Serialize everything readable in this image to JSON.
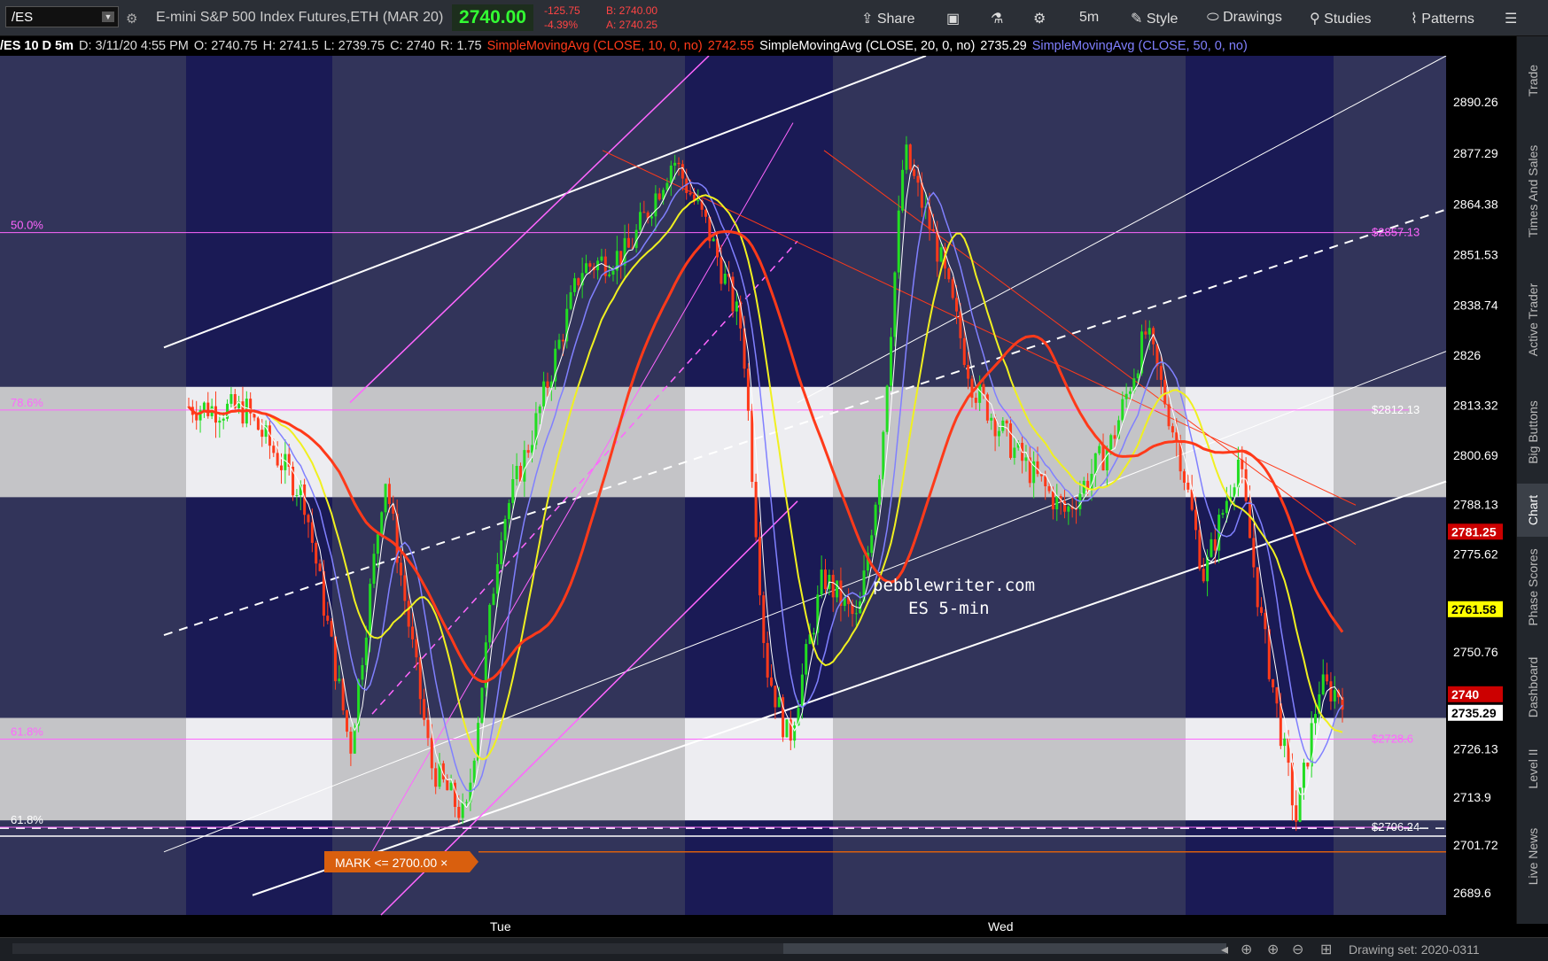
{
  "toolbar": {
    "symbol": "/ES",
    "instrument_title": "E-mini S&P 500 Index Futures,ETH (MAR 20)",
    "last_price": "2740.00",
    "change": "-125.75",
    "change_pct": "-4.39%",
    "bid": "B: 2740.00",
    "ask": "A: 2740.25",
    "share_label": "Share",
    "timeframe_label": "5m",
    "style_label": "Style",
    "drawings_label": "Drawings",
    "studies_label": "Studies",
    "patterns_label": "Patterns"
  },
  "study_bar": {
    "chart_label": "/ES 10 D 5m",
    "date": "D: 3/11/20 4:55 PM",
    "open": "O: 2740.75",
    "high": "H: 2741.5",
    "low": "L: 2739.75",
    "close": "C: 2740",
    "range": "R: 1.75",
    "sma10_label": "SimpleMovingAvg (CLOSE, 10, 0, no)",
    "sma10_value": "2742.55",
    "sma20_label": "SimpleMovingAvg (CLOSE, 20, 0, no)",
    "sma20_value": "2735.29",
    "sma50_label": "SimpleMovingAvg (CLOSE, 50, 0, no)"
  },
  "right_tabs": [
    "Trade",
    "Times And Sales",
    "Active Trader",
    "Big Buttons",
    "Chart",
    "Phase Scores",
    "Dashboard",
    "Level II",
    "Live News"
  ],
  "active_tab": "Chart",
  "bottom": {
    "drawing_set": "Drawing set: 2020-0311"
  },
  "colors": {
    "price_up": "#22dd22",
    "price_down": "#ff3a1a",
    "sma10": "#ffffff",
    "sma20": "#f0f020",
    "sma50": "#8080ff",
    "sma_long": "#ff3a1a",
    "fib": "#ff66ff",
    "mark": "#d95f0e"
  },
  "chart_data": {
    "type": "candlestick",
    "ylim": [
      2684,
      2902
    ],
    "y_ticks": [
      "2890.26",
      "2877.29",
      "2864.38",
      "2851.53",
      "2838.74",
      "2826",
      "2813.32",
      "2800.69",
      "2788.13",
      "2775.62",
      "2750.76",
      "2726.13",
      "2713.9",
      "2701.72",
      "2689.6"
    ],
    "x_labels": [
      "Tue",
      "Wed"
    ],
    "fib_levels": [
      {
        "label": "50.0%",
        "price": 2857.13,
        "price_label": "$2857.13"
      },
      {
        "label": "78.6%",
        "price": 2812.13,
        "price_label": "$2812.13"
      },
      {
        "label": "61.8%",
        "price": 2728.6,
        "price_label": "$2728.6"
      },
      {
        "label": "61.8%",
        "price": 2706.24,
        "price_label": "$2706.24"
      }
    ],
    "price_tags": [
      {
        "value": "2781.25"
      },
      {
        "value": "2761.58"
      },
      {
        "value": "2740"
      },
      {
        "value": "2735.29"
      }
    ],
    "annotation": [
      "pebblewriter.com",
      "ES 5-min"
    ],
    "mark_label": "MARK <= 2700.00 ×",
    "mark_price": 2700.0,
    "series_path": [
      [
        0,
        2813
      ],
      [
        0.05,
        2812
      ],
      [
        0.1,
        2790
      ],
      [
        0.14,
        2726
      ],
      [
        0.17,
        2796
      ],
      [
        0.21,
        2722
      ],
      [
        0.24,
        2708
      ],
      [
        0.27,
        2782
      ],
      [
        0.3,
        2808
      ],
      [
        0.34,
        2848
      ],
      [
        0.38,
        2852
      ],
      [
        0.42,
        2876
      ],
      [
        0.45,
        2858
      ],
      [
        0.48,
        2832
      ],
      [
        0.5,
        2748
      ],
      [
        0.52,
        2728
      ],
      [
        0.55,
        2770
      ],
      [
        0.58,
        2758
      ],
      [
        0.6,
        2800
      ],
      [
        0.62,
        2878
      ],
      [
        0.65,
        2852
      ],
      [
        0.68,
        2818
      ],
      [
        0.72,
        2800
      ],
      [
        0.76,
        2786
      ],
      [
        0.8,
        2804
      ],
      [
        0.83,
        2832
      ],
      [
        0.86,
        2800
      ],
      [
        0.88,
        2770
      ],
      [
        0.91,
        2800
      ],
      [
        0.93,
        2758
      ],
      [
        0.96,
        2708
      ],
      [
        0.98,
        2742
      ],
      [
        1,
        2740
      ]
    ]
  }
}
